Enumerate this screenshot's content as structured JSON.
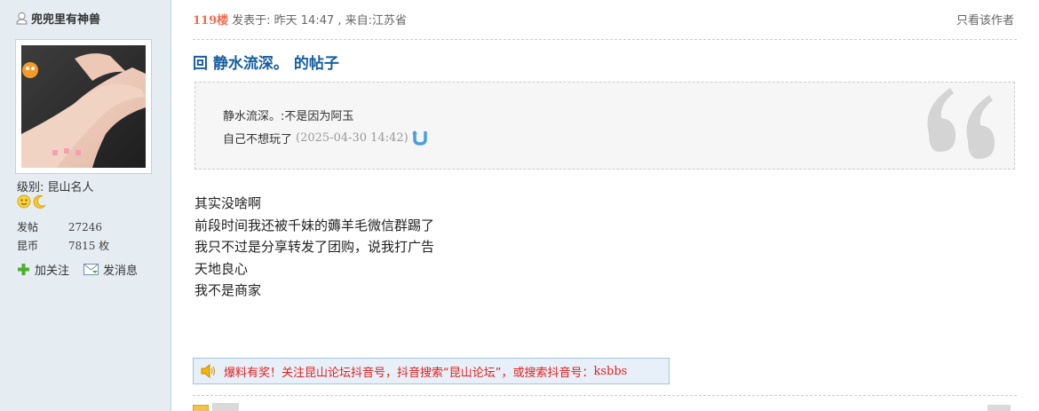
{
  "author": {
    "name": "兜兜里有神兽",
    "level_label": "级别:",
    "level_value": "昆山名人",
    "stats": [
      {
        "label": "发帖",
        "value": "27246"
      },
      {
        "label": "昆币",
        "value": "7815 枚"
      }
    ],
    "actions": {
      "follow": "加关注",
      "message": "发消息"
    }
  },
  "post": {
    "floor": "119楼",
    "meta": "发表于: 昨天 14:47 , 来自:江苏省",
    "only_author": "只看该作者",
    "title": "回 静水流深。 的帖子",
    "quote": {
      "line1": "静水流深。:不是因为阿玉",
      "line2": "自己不想玩了",
      "time": "(2025-04-30 14:42)"
    },
    "body": [
      "其实没啥啊",
      "前段时间我还被千妹的薅羊毛微信群踢了",
      "我只不过是分享转发了团购，说我打广告",
      "天地良心",
      "我不是商家"
    ],
    "promo": {
      "text": "爆料有奖！关注昆山论坛抖音号，抖音搜索“昆山论坛”，或搜索抖音号：",
      "handle": "ksbbs"
    }
  },
  "icons": [
    "user-icon",
    "avatar",
    "smile-badge-icon",
    "moon-badge-icon",
    "plus-icon",
    "mail-icon",
    "jump-arrow-icon",
    "quote-mark-icon",
    "speaker-icon"
  ],
  "colors": {
    "sidebar_bg": "#e5edf2",
    "title_blue": "#175ea0",
    "floor_orange": "#f26c4f",
    "promo_red": "#e02020"
  }
}
